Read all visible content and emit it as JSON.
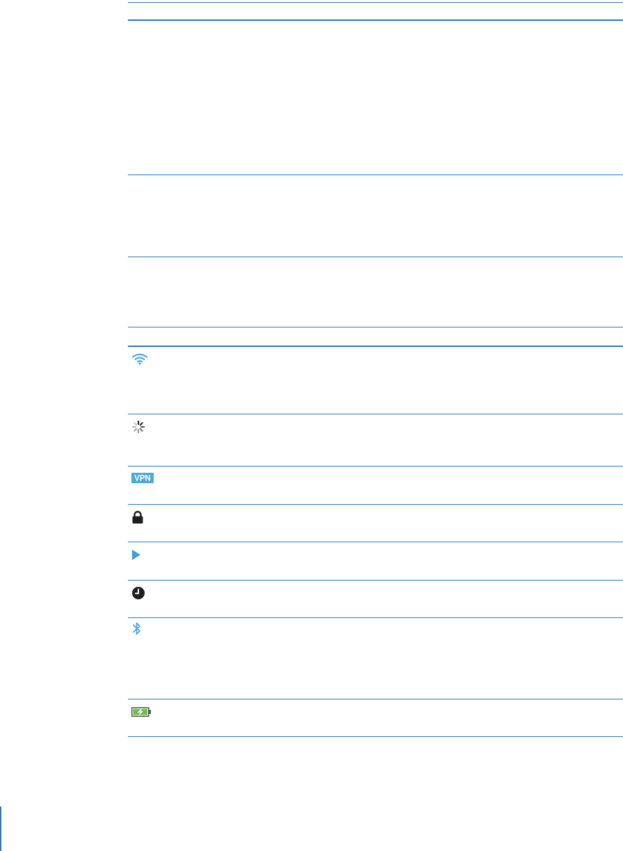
{
  "status_icons": [
    {
      "icon": "wifi-icon",
      "color": "#4aa8dc"
    },
    {
      "icon": "activity-spinner-icon",
      "color": "#555555"
    },
    {
      "icon": "vpn-icon",
      "label": "VPN",
      "color": "#4aa8dc"
    },
    {
      "icon": "lock-icon",
      "color": "#1e1e1e"
    },
    {
      "icon": "play-icon",
      "color": "#3aa0dc"
    },
    {
      "icon": "alarm-clock-icon",
      "color": "#1e1e1e"
    },
    {
      "icon": "bluetooth-icon",
      "color": "#4aa8dc"
    },
    {
      "icon": "battery-charging-icon",
      "color": "#6cc04a"
    }
  ],
  "colors": {
    "rule": "#2a78bd",
    "background": "#ffffff"
  }
}
